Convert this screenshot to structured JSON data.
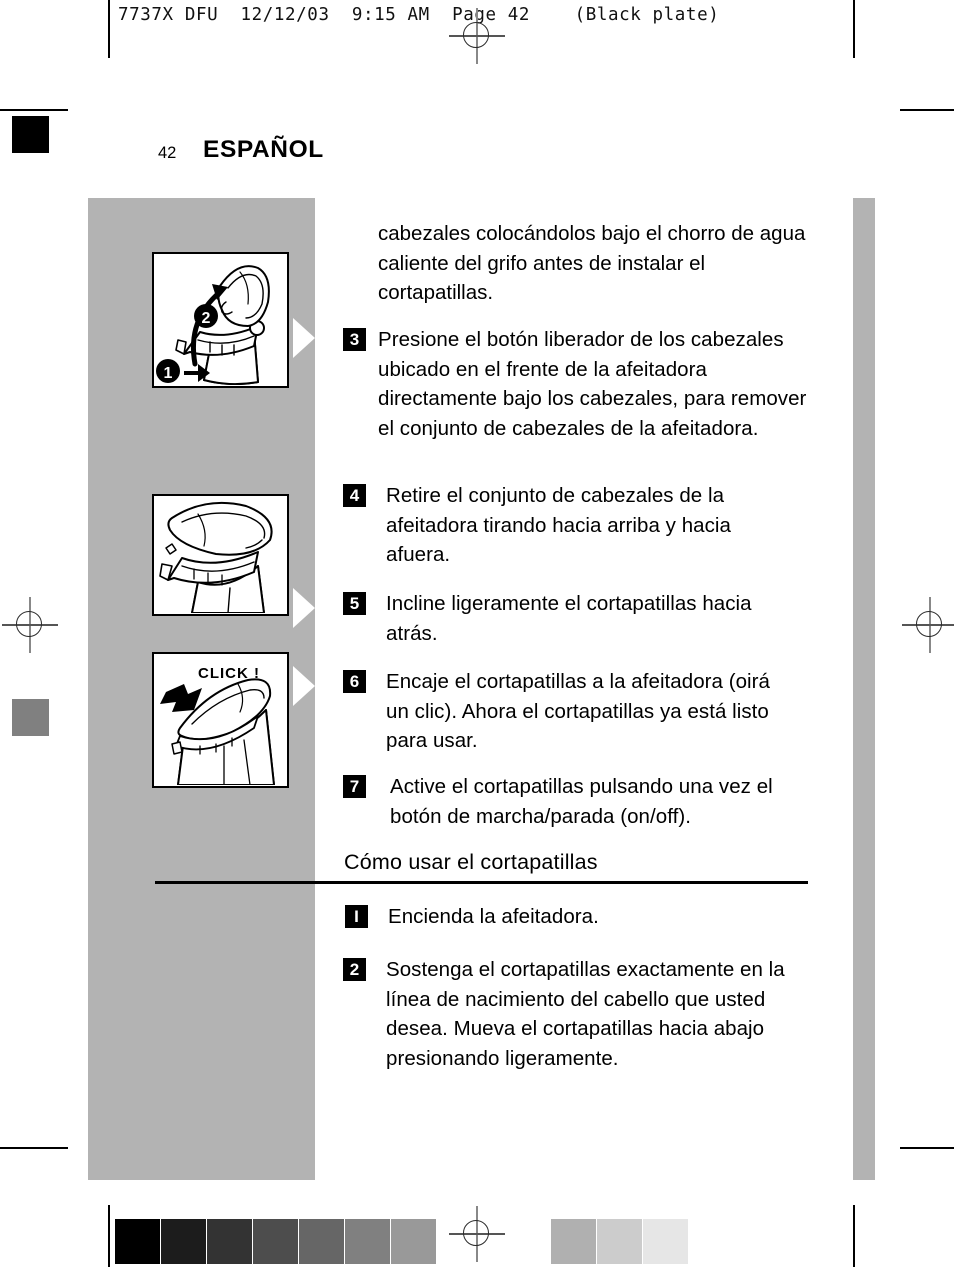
{
  "print_header": "7737X DFU  12/12/03  9:15 AM  Page 42    (Black plate)",
  "page": {
    "number": "42",
    "language_title": "ESPAÑOL"
  },
  "content": {
    "intro_paragraph": "cabezales colocándolos bajo el chorro de agua caliente del grifo antes de instalar el cortapatillas.",
    "steps_cleaning": [
      {
        "number": "3",
        "text": "Presione el botón liberador de los cabezales ubicado en el frente de la afeitadora directamente bajo los cabezales, para remover el conjunto de cabezales de la afeitadora."
      },
      {
        "number": "4",
        "text": "Retire el conjunto de cabezales de la afeitadora tirando hacia arriba y hacia afuera."
      },
      {
        "number": "5",
        "text": "Incline ligeramente el cortapatillas hacia atrás."
      },
      {
        "number": "6",
        "text": "Encaje el cortapatillas a la afeitadora (oirá un clic). Ahora el cortapatillas ya está listo para usar."
      },
      {
        "number": "7",
        "text": "Active el cortapatillas pulsando una vez el botón de marcha/parada (on/off)."
      }
    ],
    "section_heading": "Cómo usar el cortapatillas",
    "steps_usage": [
      {
        "number": "I",
        "text": "Encienda la afeitadora."
      },
      {
        "number": "2",
        "text": "Sostenga el cortapatillas exactamente en la línea de nacimiento del cabello que usted desea. Mueva el cortapatillas hacia abajo presionando ligeramente."
      }
    ]
  },
  "illustrations": [
    {
      "name": "shaver-head-open",
      "callout_1": "❶",
      "callout_2": "❷"
    },
    {
      "name": "trimmer-tilted-back",
      "callout": ""
    },
    {
      "name": "trimmer-click-in",
      "callout": "CLICK !"
    }
  ],
  "color_bar": {
    "dark_swatches": [
      "#000000",
      "#1c1c1c",
      "#333333",
      "#4d4d4d",
      "#666666",
      "#808080",
      "#999999"
    ],
    "light_swatches": [
      "#b0b0b0",
      "#cccccc",
      "#e6e6e6"
    ]
  },
  "marks": {
    "registration_black": "#000000",
    "registration_grey": "#808080",
    "band_grey": "#b3b3b3"
  }
}
